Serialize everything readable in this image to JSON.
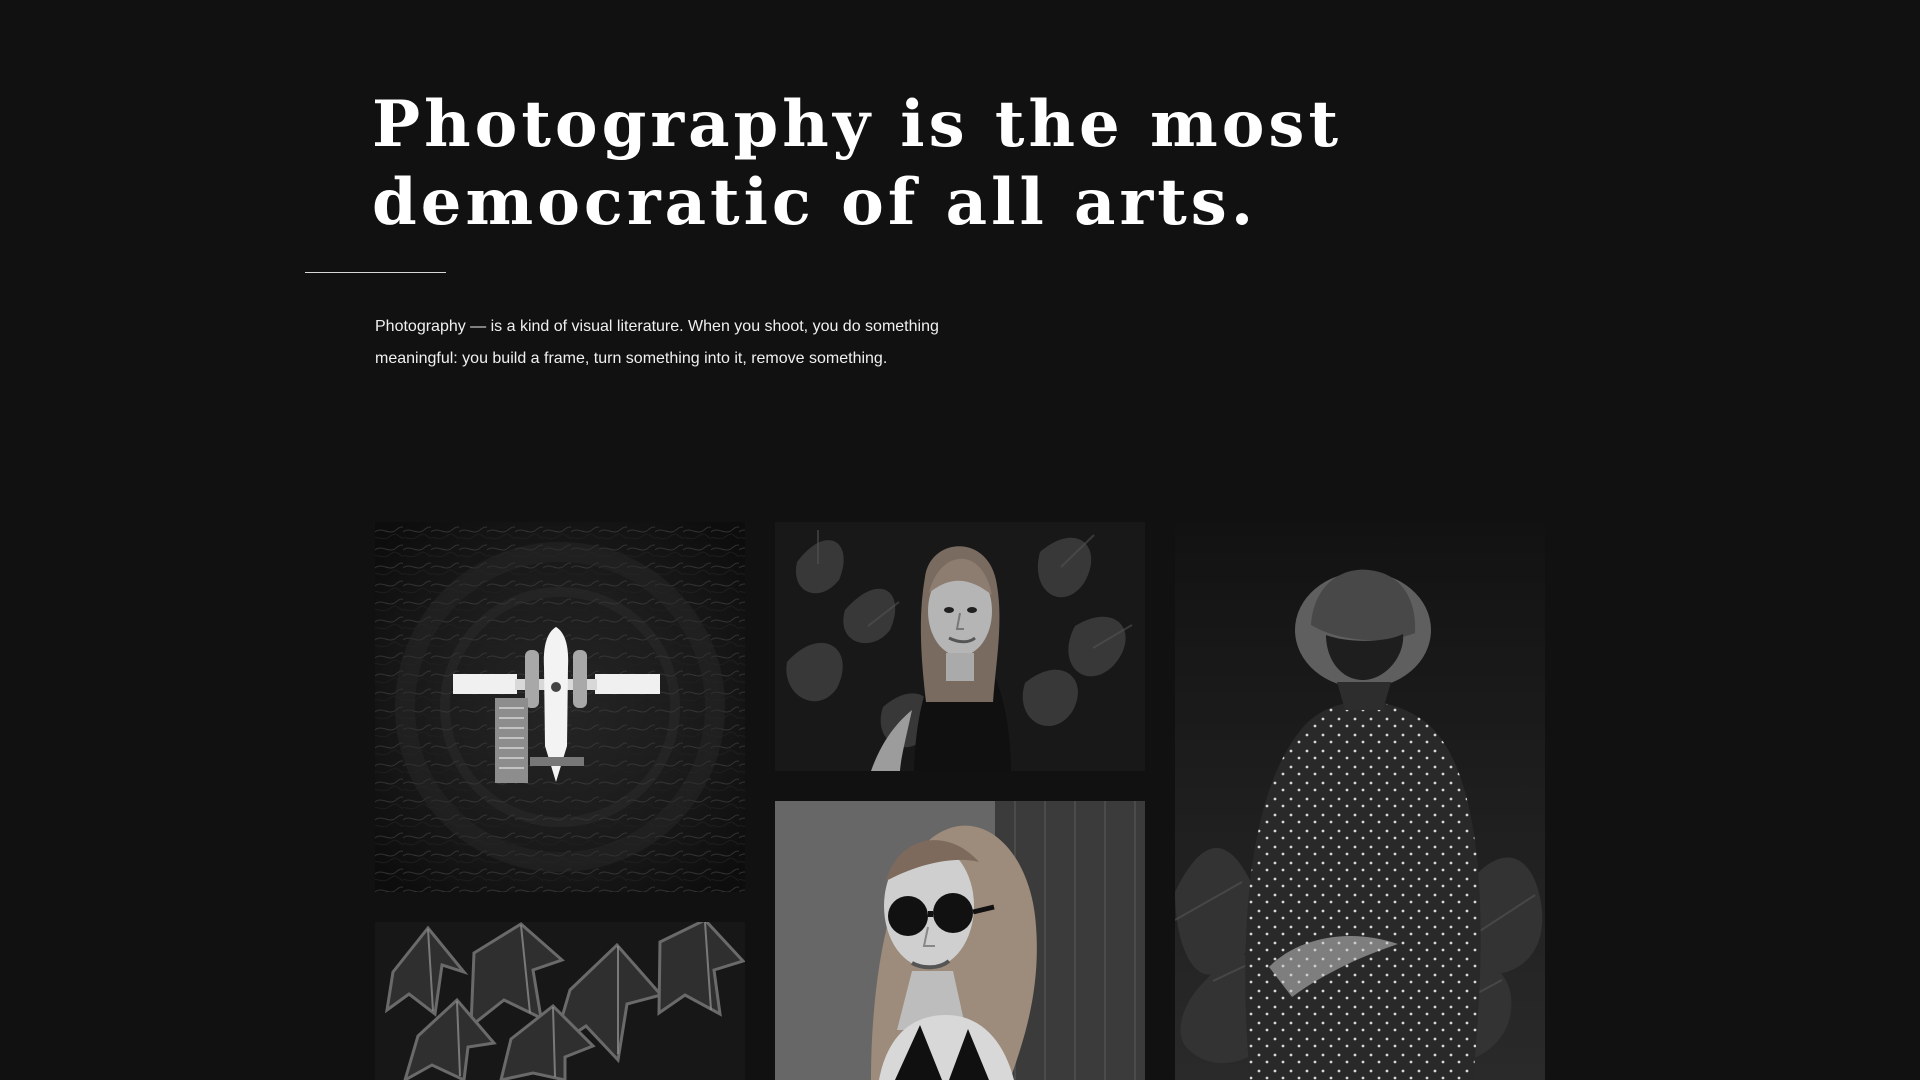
{
  "hero": {
    "title_line_1": "Photography is the most",
    "title_line_2": "democratic of all arts.",
    "intro_line_1": "Photography — is a kind of visual literature. When you shoot, you do something",
    "intro_line_2": "meaningful: you build a frame, turn something into it, remove something."
  },
  "gallery": {
    "items": [
      {
        "name": "aerial-seaplane-photo",
        "image": "black and white aerial seaplane on dark water"
      },
      {
        "name": "woman-portrait-photo",
        "image": "black and white portrait of a woman among leaves"
      },
      {
        "name": "man-hat-photo",
        "image": "black and white man in a hat and patterned shirt among plants"
      },
      {
        "name": "leaves-photo",
        "image": "black and white close-up of leaves"
      },
      {
        "name": "woman-sunglasses-photo",
        "image": "black and white woman wearing round sunglasses"
      }
    ]
  },
  "colors": {
    "background": "#111111",
    "text": "#ffffff",
    "divider": "#d8d8d8"
  }
}
